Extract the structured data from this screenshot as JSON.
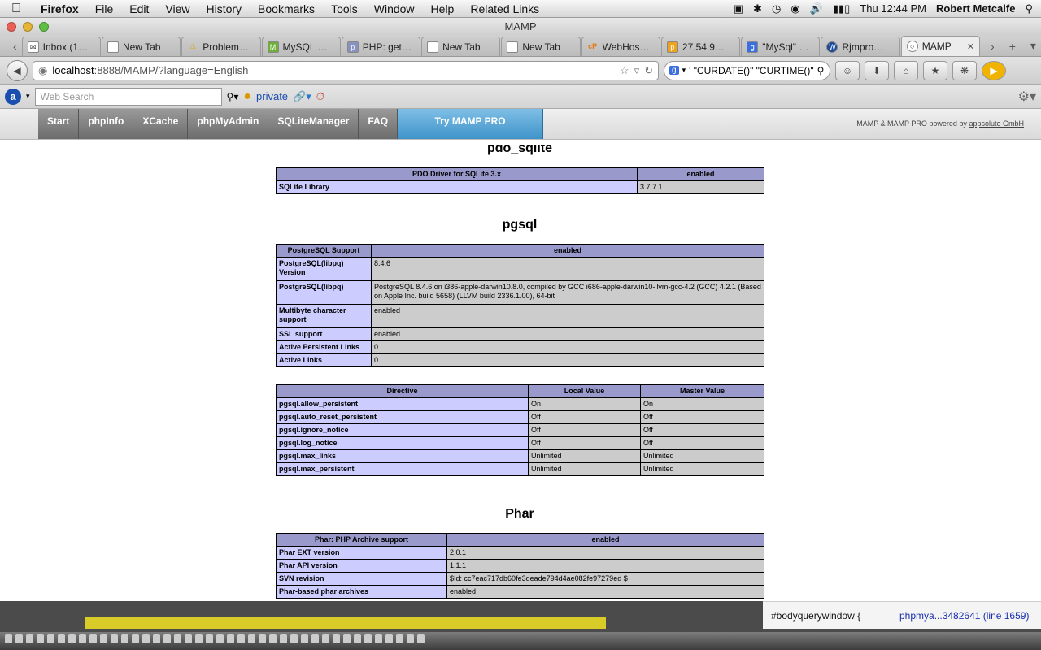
{
  "menubar": {
    "app": "Firefox",
    "items": [
      "File",
      "Edit",
      "View",
      "History",
      "Bookmarks",
      "Tools",
      "Window",
      "Help",
      "Related Links"
    ],
    "clock": "Thu 12:44 PM",
    "user": "Robert Metcalfe"
  },
  "window": {
    "title": "MAMP"
  },
  "tabs": [
    {
      "label": "Inbox (1…",
      "icon": "mail-icon"
    },
    {
      "label": "New Tab",
      "icon": "blank-page-icon"
    },
    {
      "label": "Problem…",
      "icon": "warning-icon"
    },
    {
      "label": "MySQL …",
      "icon": "mysql-icon"
    },
    {
      "label": "PHP: get…",
      "icon": "php-icon"
    },
    {
      "label": "New Tab",
      "icon": "blank-page-icon"
    },
    {
      "label": "New Tab",
      "icon": "blank-page-icon"
    },
    {
      "label": "WebHos…",
      "icon": "cpanel-icon"
    },
    {
      "label": "27.54.9…",
      "icon": "phpmyadmin-icon"
    },
    {
      "label": "\"MySql\" …",
      "icon": "google-icon"
    },
    {
      "label": "Rjmpro…",
      "icon": "wordpress-icon"
    },
    {
      "label": "MAMP",
      "icon": "globe-icon",
      "active": true
    }
  ],
  "nav": {
    "url_host": "localhost",
    "url_rest": ":8888/MAMP/?language=English",
    "search_value": "' \"CURDATE()\" \"CURTIME()\""
  },
  "addon": {
    "web_search_placeholder": "Web Search",
    "private_label": "private"
  },
  "mamp": {
    "nav": [
      "Start",
      "phpInfo",
      "XCache",
      "phpMyAdmin",
      "SQLiteManager",
      "FAQ"
    ],
    "pro_button": "Try MAMP PRO",
    "powered_text": "MAMP & MAMP PRO powered by",
    "powered_link": "appsolute GmbH"
  },
  "phpinfo": {
    "pdo_sqlite": {
      "title": "pdo_sqlite",
      "header": [
        "PDO Driver for SQLite 3.x",
        "enabled"
      ],
      "rows": [
        [
          "SQLite Library",
          "3.7.7.1"
        ]
      ]
    },
    "pgsql": {
      "title": "pgsql",
      "header": [
        "PostgreSQL Support",
        "enabled"
      ],
      "rows": [
        [
          "PostgreSQL(libpq) Version",
          "8.4.6"
        ],
        [
          "PostgreSQL(libpq)",
          "PostgreSQL 8.4.6 on i386-apple-darwin10.8.0, compiled by GCC i686-apple-darwin10-llvm-gcc-4.2 (GCC) 4.2.1 (Based on Apple Inc. build 5658) (LLVM build 2336.1.00), 64-bit"
        ],
        [
          "Multibyte character support",
          "enabled"
        ],
        [
          "SSL support",
          "enabled"
        ],
        [
          "Active Persistent Links",
          "0"
        ],
        [
          "Active Links",
          "0"
        ]
      ],
      "directive_header": [
        "Directive",
        "Local Value",
        "Master Value"
      ],
      "directives": [
        [
          "pgsql.allow_persistent",
          "On",
          "On"
        ],
        [
          "pgsql.auto_reset_persistent",
          "Off",
          "Off"
        ],
        [
          "pgsql.ignore_notice",
          "Off",
          "Off"
        ],
        [
          "pgsql.log_notice",
          "Off",
          "Off"
        ],
        [
          "pgsql.max_links",
          "Unlimited",
          "Unlimited"
        ],
        [
          "pgsql.max_persistent",
          "Unlimited",
          "Unlimited"
        ]
      ]
    },
    "phar": {
      "title": "Phar",
      "header": [
        "Phar: PHP Archive support",
        "enabled"
      ],
      "rows": [
        [
          "Phar EXT version",
          "2.0.1"
        ],
        [
          "Phar API version",
          "1.1.1"
        ],
        [
          "SVN revision",
          "$Id: cc7eac717db60fe3deade794d4ae082fe97279ed $"
        ],
        [
          "Phar-based phar archives",
          "enabled"
        ]
      ]
    }
  },
  "background_editor": {
    "text": "#bodyquerywindow {",
    "link": "phpmya...3482641 (line 1659)"
  }
}
